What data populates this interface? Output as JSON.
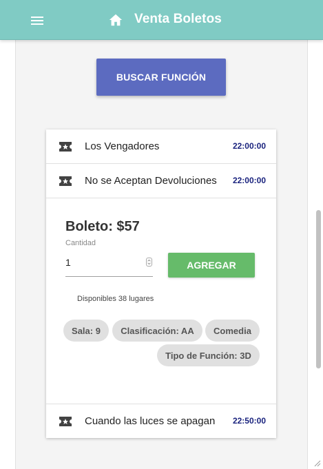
{
  "appbar": {
    "title": "Venta Boletos",
    "menu_icon": "hamburger-menu-icon",
    "home_icon": "home-icon",
    "background": "#80cbc4"
  },
  "search": {
    "label": "BUSCAR FUNCIÓN",
    "color": "#5c6bc0"
  },
  "movies": [
    {
      "title": "Los Vengadores",
      "time": "22:00:00"
    },
    {
      "title": "No se Aceptan Devoluciones",
      "time": "22:00:00"
    },
    {
      "title": "Cuando las luces se apagan",
      "time": "22:50:00"
    }
  ],
  "detail": {
    "price": "Boleto: $57",
    "quantity_label": "Cantidad",
    "quantity_value": "1",
    "add_label": "AGREGAR",
    "add_color": "#66bb6a",
    "available": "Disponibles 38 lugares",
    "chips": [
      "Sala: 9",
      "Clasificación: AA",
      "Comedia",
      "Tipo de Función: 3D"
    ]
  }
}
